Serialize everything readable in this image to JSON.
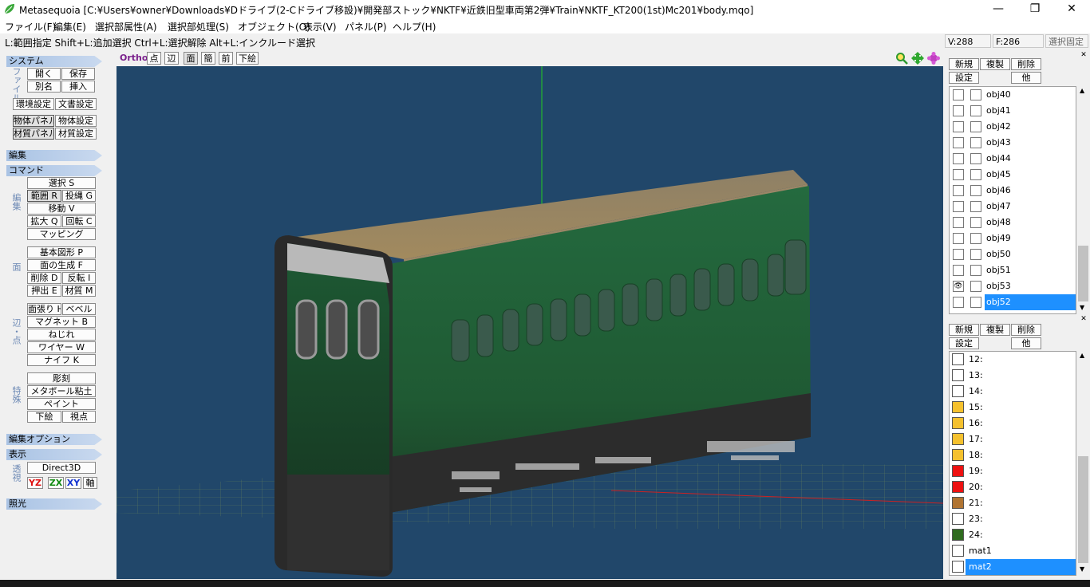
{
  "window": {
    "title": "Metasequoia [C:¥Users¥owner¥Downloads¥Dドライブ(2-Cドライブ移設)¥開発部ストック¥NKTF¥近鉄旧型車両第2弾¥Train¥NKTF_KT200(1st)Mc201¥body.mqo]",
    "minimize": "—",
    "maximize": "❐",
    "close": "✕"
  },
  "menu": [
    "ファイル(F)",
    "編集(E)",
    "選択部属性(A)",
    "選択部処理(S)",
    "オブジェクト(O)",
    "表示(V)",
    "パネル(P)",
    "ヘルプ(H)"
  ],
  "hint": "L:範囲指定  Shift+L:追加選択  Ctrl+L:選択解除  Alt+L:インクルード選択",
  "status": {
    "vertices": "V:288",
    "faces": "F:286",
    "lock": "選択固定"
  },
  "left": {
    "system": "システム",
    "file_label": "ファイル",
    "open": "開く",
    "save": "保存",
    "saveas": "別名",
    "insert": "挿入",
    "env": "環境設定",
    "doc": "文書設定",
    "objpanel": "物体パネル",
    "objset": "物体設定",
    "matpanel": "材質パネル",
    "matset": "材質設定",
    "edit": "編集",
    "command": "コマンド",
    "edit_label": "編集",
    "select": "選択 S",
    "range": "範囲 R",
    "lasso": "投縄 G",
    "move": "移動 V",
    "scale": "拡大 Q",
    "rotate": "回転 C",
    "mapping": "マッピング",
    "face_label": "面",
    "prim": "基本図形 P",
    "facegen": "面の生成 F",
    "delete": "削除 D",
    "flip": "反転 I",
    "extrude": "押出 E",
    "material": "材質 M",
    "edgept_label": "辺・点",
    "stretch": "面張り H",
    "bevel": "ベベル",
    "magnet": "マグネット B",
    "twist": "ねじれ",
    "wire": "ワイヤー W",
    "knife": "ナイフ K",
    "special_label": "特殊",
    "sculpt": "彫刻",
    "metaball": "メタボール粘土",
    "paint": "ペイント",
    "underlay": "下絵",
    "viewpoint": "視点",
    "editopt": "編集オプション",
    "display": "表示",
    "persp_label": "透視",
    "direct3d": "Direct3D",
    "yz": "YZ",
    "zx": "ZX",
    "xy": "XY",
    "axis": "軸",
    "light": "照光"
  },
  "viewport": {
    "ortho": "Ortho",
    "buttons": [
      "点",
      "辺",
      "面",
      "簡",
      "前",
      "下絵"
    ]
  },
  "objpanel": {
    "new": "新規",
    "dup": "複製",
    "del": "削除",
    "set": "設定",
    "other": "他",
    "objects": [
      {
        "name": "obj40",
        "eye": ""
      },
      {
        "name": "obj41",
        "eye": ""
      },
      {
        "name": "obj42",
        "eye": ""
      },
      {
        "name": "obj43",
        "eye": ""
      },
      {
        "name": "obj44",
        "eye": ""
      },
      {
        "name": "obj45",
        "eye": ""
      },
      {
        "name": "obj46",
        "eye": ""
      },
      {
        "name": "obj47",
        "eye": ""
      },
      {
        "name": "obj48",
        "eye": ""
      },
      {
        "name": "obj49",
        "eye": ""
      },
      {
        "name": "obj50",
        "eye": ""
      },
      {
        "name": "obj51",
        "eye": ""
      },
      {
        "name": "obj53",
        "eye": "👁"
      },
      {
        "name": "obj52",
        "eye": ""
      }
    ]
  },
  "matpanel": {
    "new": "新規",
    "dup": "複製",
    "del": "削除",
    "set": "設定",
    "other": "他",
    "materials": [
      {
        "name": "12:",
        "color": "#ffffff"
      },
      {
        "name": "13:",
        "color": "#ffffff"
      },
      {
        "name": "14:",
        "color": "#ffffff"
      },
      {
        "name": "15:",
        "color": "#f5c12e"
      },
      {
        "name": "16:",
        "color": "#f5c12e"
      },
      {
        "name": "17:",
        "color": "#f5c12e"
      },
      {
        "name": "18:",
        "color": "#f5c12e"
      },
      {
        "name": "19:",
        "color": "#ee1111"
      },
      {
        "name": "20:",
        "color": "#ee1111"
      },
      {
        "name": "21:",
        "color": "#b07432"
      },
      {
        "name": "23:",
        "color": "#ffffff"
      },
      {
        "name": "24:",
        "color": "#2f6b1e"
      },
      {
        "name": "mat1",
        "color": "#ffffff"
      },
      {
        "name": "mat2",
        "color": "#ffffff"
      }
    ]
  }
}
